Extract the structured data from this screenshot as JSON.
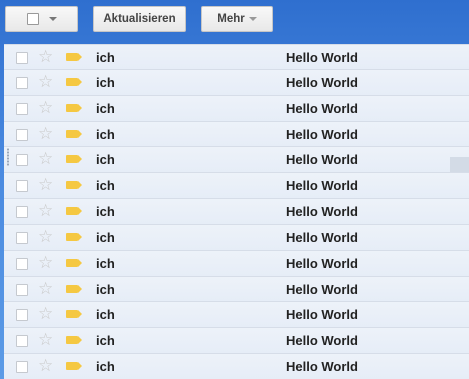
{
  "toolbar": {
    "select_icon": "checkbox-icon",
    "select_caret": "chevron-down-icon",
    "refresh_label": "Aktualisieren",
    "more_label": "Mehr"
  },
  "rows": [
    {
      "sender": "ich",
      "subject": "Hello World"
    },
    {
      "sender": "ich",
      "subject": "Hello World"
    },
    {
      "sender": "ich",
      "subject": "Hello World"
    },
    {
      "sender": "ich",
      "subject": "Hello World"
    },
    {
      "sender": "ich",
      "subject": "Hello World"
    },
    {
      "sender": "ich",
      "subject": "Hello World"
    },
    {
      "sender": "ich",
      "subject": "Hello World"
    },
    {
      "sender": "ich",
      "subject": "Hello World"
    },
    {
      "sender": "ich",
      "subject": "Hello World"
    },
    {
      "sender": "ich",
      "subject": "Hello World"
    },
    {
      "sender": "ich",
      "subject": "Hello World"
    },
    {
      "sender": "ich",
      "subject": "Hello World"
    },
    {
      "sender": "ich",
      "subject": "Hello World"
    }
  ],
  "colors": {
    "background": "#3f7fd9",
    "row": "#e9eff8",
    "label": "#f5c842",
    "star": "#c9c9c9"
  }
}
